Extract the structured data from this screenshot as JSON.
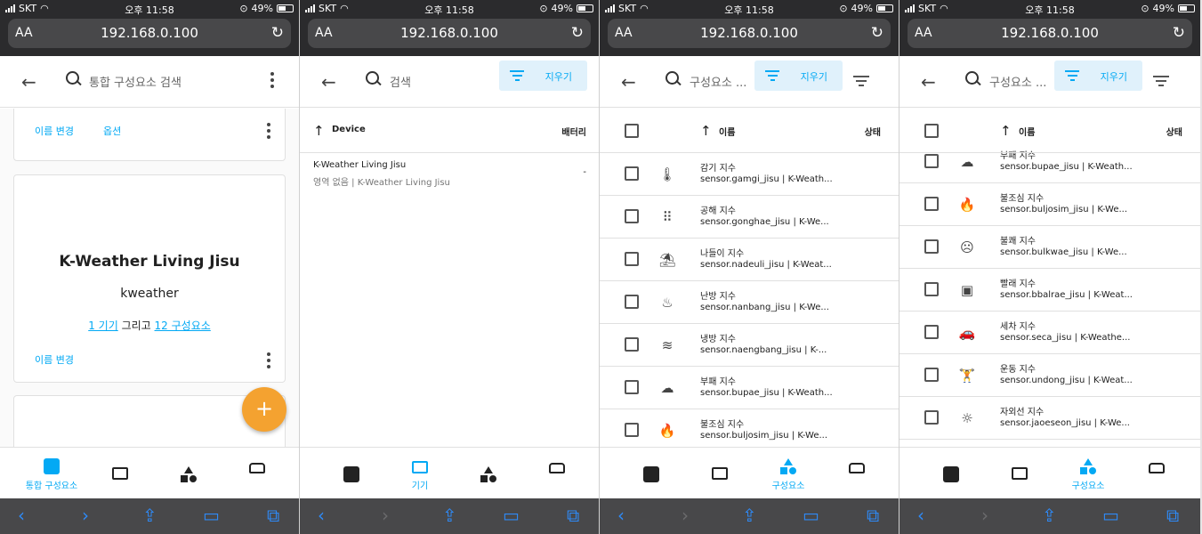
{
  "status": {
    "carrier": "SKT",
    "time": "오후 11:58",
    "battery": "49%"
  },
  "browser": {
    "aa_label": "AA",
    "url": "192.168.0.100"
  },
  "panel1": {
    "search_placeholder": "통합 구성요소 검색",
    "top_card": {
      "rename": "이름 변경",
      "options": "옵션"
    },
    "card": {
      "title": "K-Weather Living Jisu",
      "subtitle": "kweather",
      "devices_link": "1 기기",
      "connector": "그리고",
      "entities_link": "12 구성요소",
      "rename": "이름 변경"
    },
    "fab_label": "+",
    "active_tab_label": "통합 구성요소"
  },
  "panel2": {
    "search_placeholder": "검색",
    "filter_clear": "지우기",
    "col_device": "Device",
    "col_battery": "배터리",
    "row": {
      "name": "K-Weather Living Jisu",
      "sub": "영역 없음 | K-Weather Living Jisu",
      "battery": "-"
    },
    "active_tab_label": "기기"
  },
  "panel3": {
    "search_placeholder": "구성요소 ...",
    "filter_clear": "지우기",
    "col_name": "이름",
    "col_status": "상태",
    "rows": [
      {
        "name": "감기 지수",
        "sub": "sensor.gamgi_jisu | K-Weath...",
        "icon": "thermometer-icon"
      },
      {
        "name": "공해 지수",
        "sub": "sensor.gonghae_jisu | K-We...",
        "icon": "dots-grid-icon"
      },
      {
        "name": "나들이 지수",
        "sub": "sensor.nadeuli_jisu | K-Weat...",
        "icon": "beach-icon"
      },
      {
        "name": "난방 지수",
        "sub": "sensor.nanbang_jisu | K-We...",
        "icon": "radiator-icon"
      },
      {
        "name": "냉방 지수",
        "sub": "sensor.naengbang_jisu | K-...",
        "icon": "air-conditioner-icon"
      },
      {
        "name": "부패 지수",
        "sub": "sensor.bupae_jisu | K-Weath...",
        "icon": "emoticon-poop-icon"
      },
      {
        "name": "불조심 지수",
        "sub": "sensor.buljosim_jisu | K-We...",
        "icon": "fire-icon"
      }
    ],
    "active_tab_label": "구성요소"
  },
  "panel4": {
    "search_placeholder": "구성요소 ...",
    "filter_clear": "지우기",
    "col_name": "이름",
    "col_status": "상태",
    "rows": [
      {
        "name": "부패 지수",
        "sub": "sensor.bupae_jisu | K-Weath...",
        "icon": "emoticon-poop-icon"
      },
      {
        "name": "불조심 지수",
        "sub": "sensor.buljosim_jisu | K-We...",
        "icon": "fire-icon"
      },
      {
        "name": "불쾌 지수",
        "sub": "sensor.bulkwae_jisu | K-We...",
        "icon": "emoticon-sad-icon"
      },
      {
        "name": "빨래 지수",
        "sub": "sensor.bbalrae_jisu | K-Weat...",
        "icon": "washing-machine-icon"
      },
      {
        "name": "세차 지수",
        "sub": "sensor.seca_jisu | K-Weathe...",
        "icon": "car-wash-icon"
      },
      {
        "name": "운동 지수",
        "sub": "sensor.undong_jisu | K-Weat...",
        "icon": "weight-lifter-icon"
      },
      {
        "name": "자외선 지수",
        "sub": "sensor.jaoeseon_jisu | K-We...",
        "icon": "sun-alert-icon"
      }
    ],
    "active_tab_label": "구성요소"
  },
  "colors": {
    "accent": "#03a9f4",
    "fab": "#f4a230",
    "chip_bg": "#e0f1fb",
    "safari_link": "#2e8af7"
  }
}
